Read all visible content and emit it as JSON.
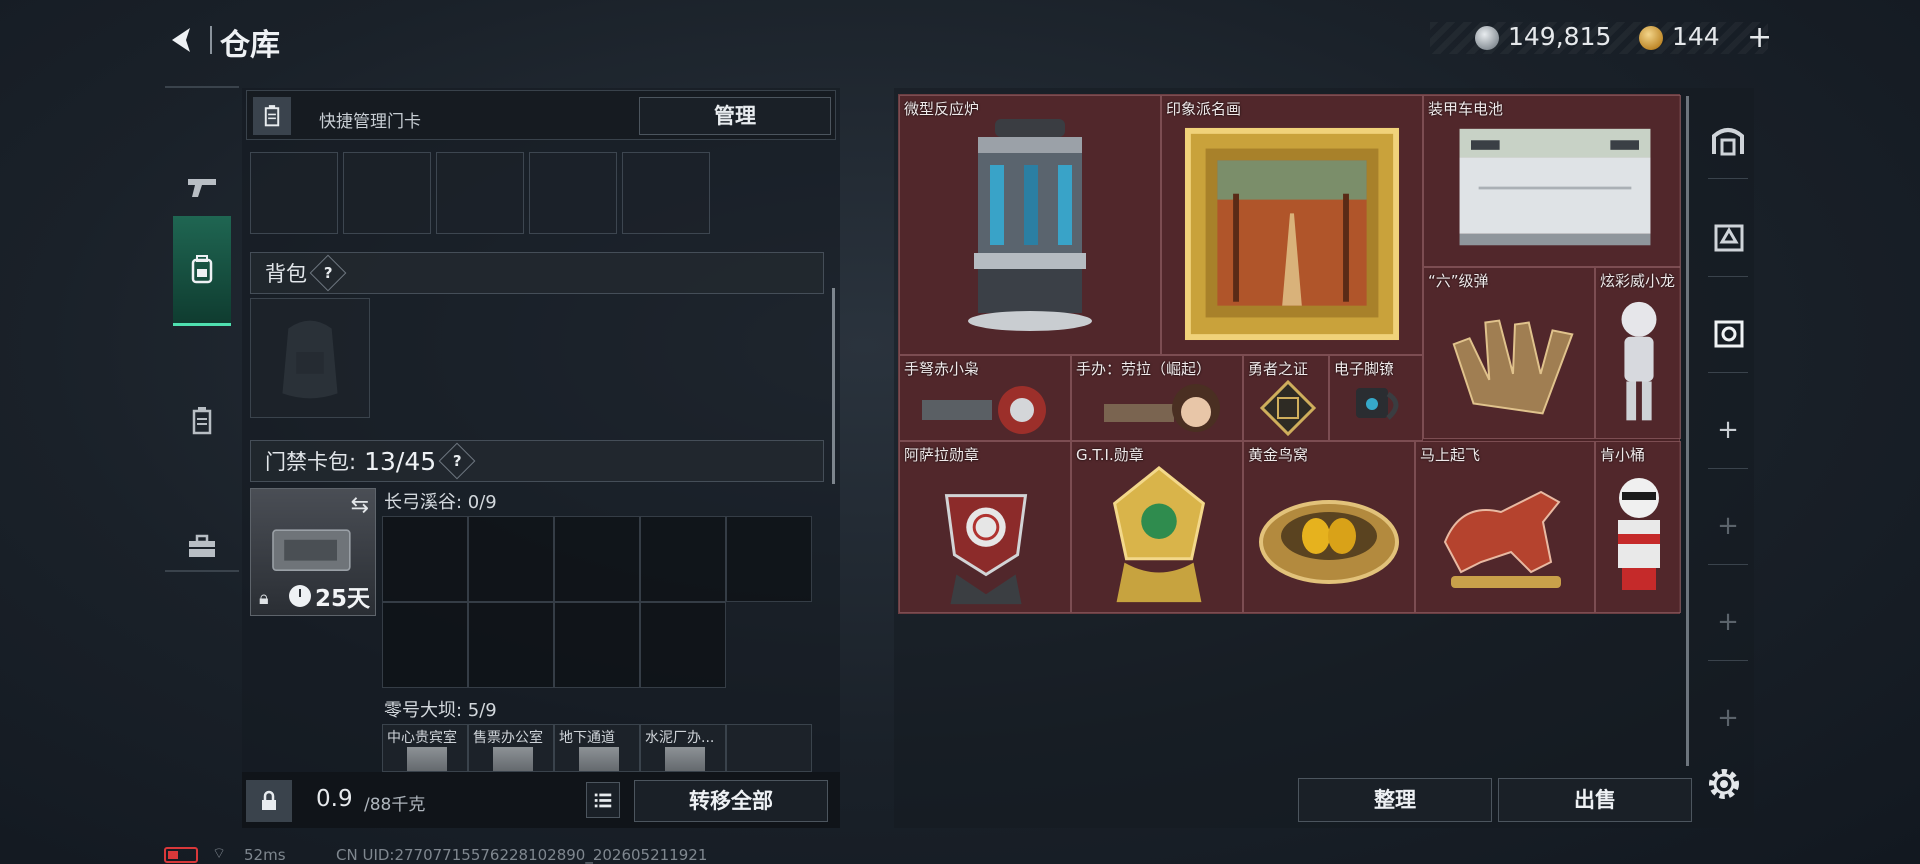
{
  "header": {
    "title": "仓库",
    "currency": [
      {
        "icon": "silver-coin-icon",
        "value": "149,815"
      },
      {
        "icon": "gold-triangle-coin-icon",
        "value": "144"
      }
    ],
    "add_currency_label": "+"
  },
  "left_nav": {
    "tabs": [
      {
        "name": "weapons",
        "icon": "pistol-icon",
        "active": false
      },
      {
        "name": "backpack",
        "icon": "backpack-icon",
        "active": true
      },
      {
        "name": "cards",
        "icon": "card-holder-icon",
        "active": false
      },
      {
        "name": "cases",
        "icon": "briefcase-icon",
        "active": false
      }
    ]
  },
  "left_panel": {
    "quick_bar": {
      "label": "快捷管理门卡",
      "manage_label": "管理"
    },
    "backpack_label": "背包",
    "help_symbol": "?",
    "keycard_label": "门禁卡包:",
    "keycard_count": "13/45",
    "keycard": {
      "days": "25天"
    },
    "maps": [
      {
        "label": "长弓溪谷: 0/9"
      },
      {
        "label": "零号大坝: 5/9",
        "rooms": [
          "中心贵宾室",
          "售票办公室",
          "地下通道",
          "水泥厂办..."
        ]
      }
    ],
    "weight": {
      "value": "0.9",
      "unit": "/88千克"
    },
    "transfer_label": "转移全部"
  },
  "items": [
    {
      "name": "微型反应炉",
      "icon": "reactor-icon"
    },
    {
      "name": "印象派名画",
      "icon": "framed-painting-icon"
    },
    {
      "name": "装甲车电池",
      "icon": "battery-pack-icon"
    },
    {
      "name": "“六”级弹",
      "icon": "golden-hand-icon"
    },
    {
      "name": "炫彩威小龙",
      "icon": "figurine-icon"
    },
    {
      "name": "手弩赤小枭",
      "icon": "crossbow-figure-icon"
    },
    {
      "name": "手办：劳拉（崛起）",
      "icon": "lara-figure-icon"
    },
    {
      "name": "勇者之证",
      "icon": "badge-icon"
    },
    {
      "name": "电子脚镣",
      "icon": "ankle-monitor-icon"
    },
    {
      "name": "阿萨拉勋章",
      "icon": "asala-medal-icon"
    },
    {
      "name": "G.T.I.勋章",
      "icon": "gti-medal-icon"
    },
    {
      "name": "黄金鸟窝",
      "icon": "golden-nest-icon"
    },
    {
      "name": "马上起飞",
      "icon": "horse-statue-icon"
    },
    {
      "name": "肯小桶",
      "icon": "bucket-figure-icon"
    }
  ],
  "actions": {
    "sort_label": "整理",
    "sell_label": "出售"
  },
  "status_bar": {
    "ping": "52ms",
    "uid": "CN UID:27707715576228102890_202605211921"
  },
  "colors": {
    "grid_bg": "#4a2326",
    "active_tab": "#1f6652",
    "accent": "#4fe0b0"
  }
}
